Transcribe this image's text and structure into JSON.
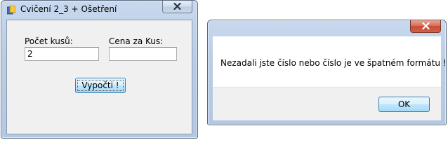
{
  "main_window": {
    "title": "Cvičení 2_3 + Ošetření",
    "pieces_label": "Počet kusů:",
    "pieces_value": "2",
    "price_label": "Cena za Kus:",
    "price_value": "",
    "calculate_label": "Vypočti !"
  },
  "message_box": {
    "title": "",
    "message": "Nezadali jste číslo nebo číslo je ve špatném formátu !",
    "ok_label": "OK"
  },
  "colors": {
    "title_bar": "#b9cde6",
    "close_button_red": "#c84c33",
    "dialog_face": "#f0f0f0"
  },
  "icons": [
    "app-icon",
    "close-icon"
  ]
}
